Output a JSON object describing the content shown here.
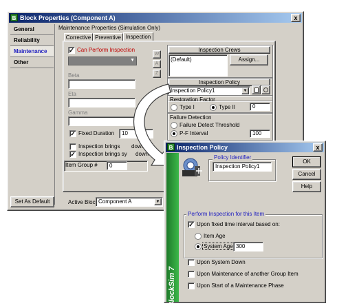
{
  "main_window": {
    "title": "Block Properties (Component A)",
    "close_label": "x",
    "nav": {
      "items": [
        {
          "label": "General"
        },
        {
          "label": "Reliability"
        },
        {
          "label": "Maintenance"
        },
        {
          "label": "Other"
        }
      ],
      "active": "Maintenance"
    },
    "group_label": "Maintenance Properties (Simulation Only)",
    "tabs": [
      {
        "label": "Corrective"
      },
      {
        "label": "Preventive"
      },
      {
        "label": "Inspection"
      }
    ],
    "can_perform_inspection_label": "Can Perform Inspection",
    "beta_label": "Beta",
    "eta_label": "Eta",
    "gamma_label": "Gamma",
    "fixed_duration_label": "Fixed Duration",
    "fixed_duration_value": "10",
    "inspection_brings_down_label": "Inspection brings",
    "inspection_brings_down_suffix": "down",
    "inspection_brings_sys_down_label": "Inspection brings sy",
    "inspection_brings_sys_down_suffix": "down",
    "item_group_label": "Item Group #",
    "item_group_value": "0",
    "inspection_crews_header": "Inspection Crews",
    "crew_value": "(Default)",
    "assign_button": "Assign...",
    "inspection_policy_header": "Inspection Policy",
    "inspection_policy_value": "Inspection Policy1",
    "restoration_factor_label": "Restoration Factor",
    "type1_label": "Type I",
    "type2_label": "Type II",
    "restoration_value": "0",
    "failure_detection_label": "Failure Detection",
    "failure_detect_threshold_label": "Failure Detect Threshold",
    "pf_interval_label": "P-F Interval",
    "pf_interval_value": "100",
    "tool_button_labels": [
      "W",
      "A",
      "Z"
    ],
    "set_as_default_button": "Set As Default",
    "active_block_label": "Active Block:",
    "active_block_value": "Component A",
    "colors": {
      "title_bar": "#0a246a",
      "nav_active_text": "#2020c0",
      "inspection_label": "#c00000"
    }
  },
  "policy_dialog": {
    "title": "Inspection Policy",
    "close_label": "x",
    "sidebar_text": "BlockSim 7",
    "policy_identifier_label": "Policy Identifier",
    "policy_identifier_value": "Inspection Policy1",
    "ok_button": "OK",
    "cancel_button": "Cancel",
    "help_button": "Help",
    "perform_group_label": "Perform Inspection for this Item",
    "upon_fixed_interval_label": "Upon fixed time interval based on:",
    "item_age_label": "Item Age",
    "system_age_label": "System Age",
    "system_age_value": "300",
    "upon_system_down_label": "Upon System Down",
    "upon_maintenance_label": "Upon Maintenance of another Group Item",
    "upon_phase_start_label": "Upon Start of a Maintenance Phase",
    "colors": {
      "sidebar_green": "#2e9e3a",
      "group_label_blue": "#2020c0"
    }
  }
}
